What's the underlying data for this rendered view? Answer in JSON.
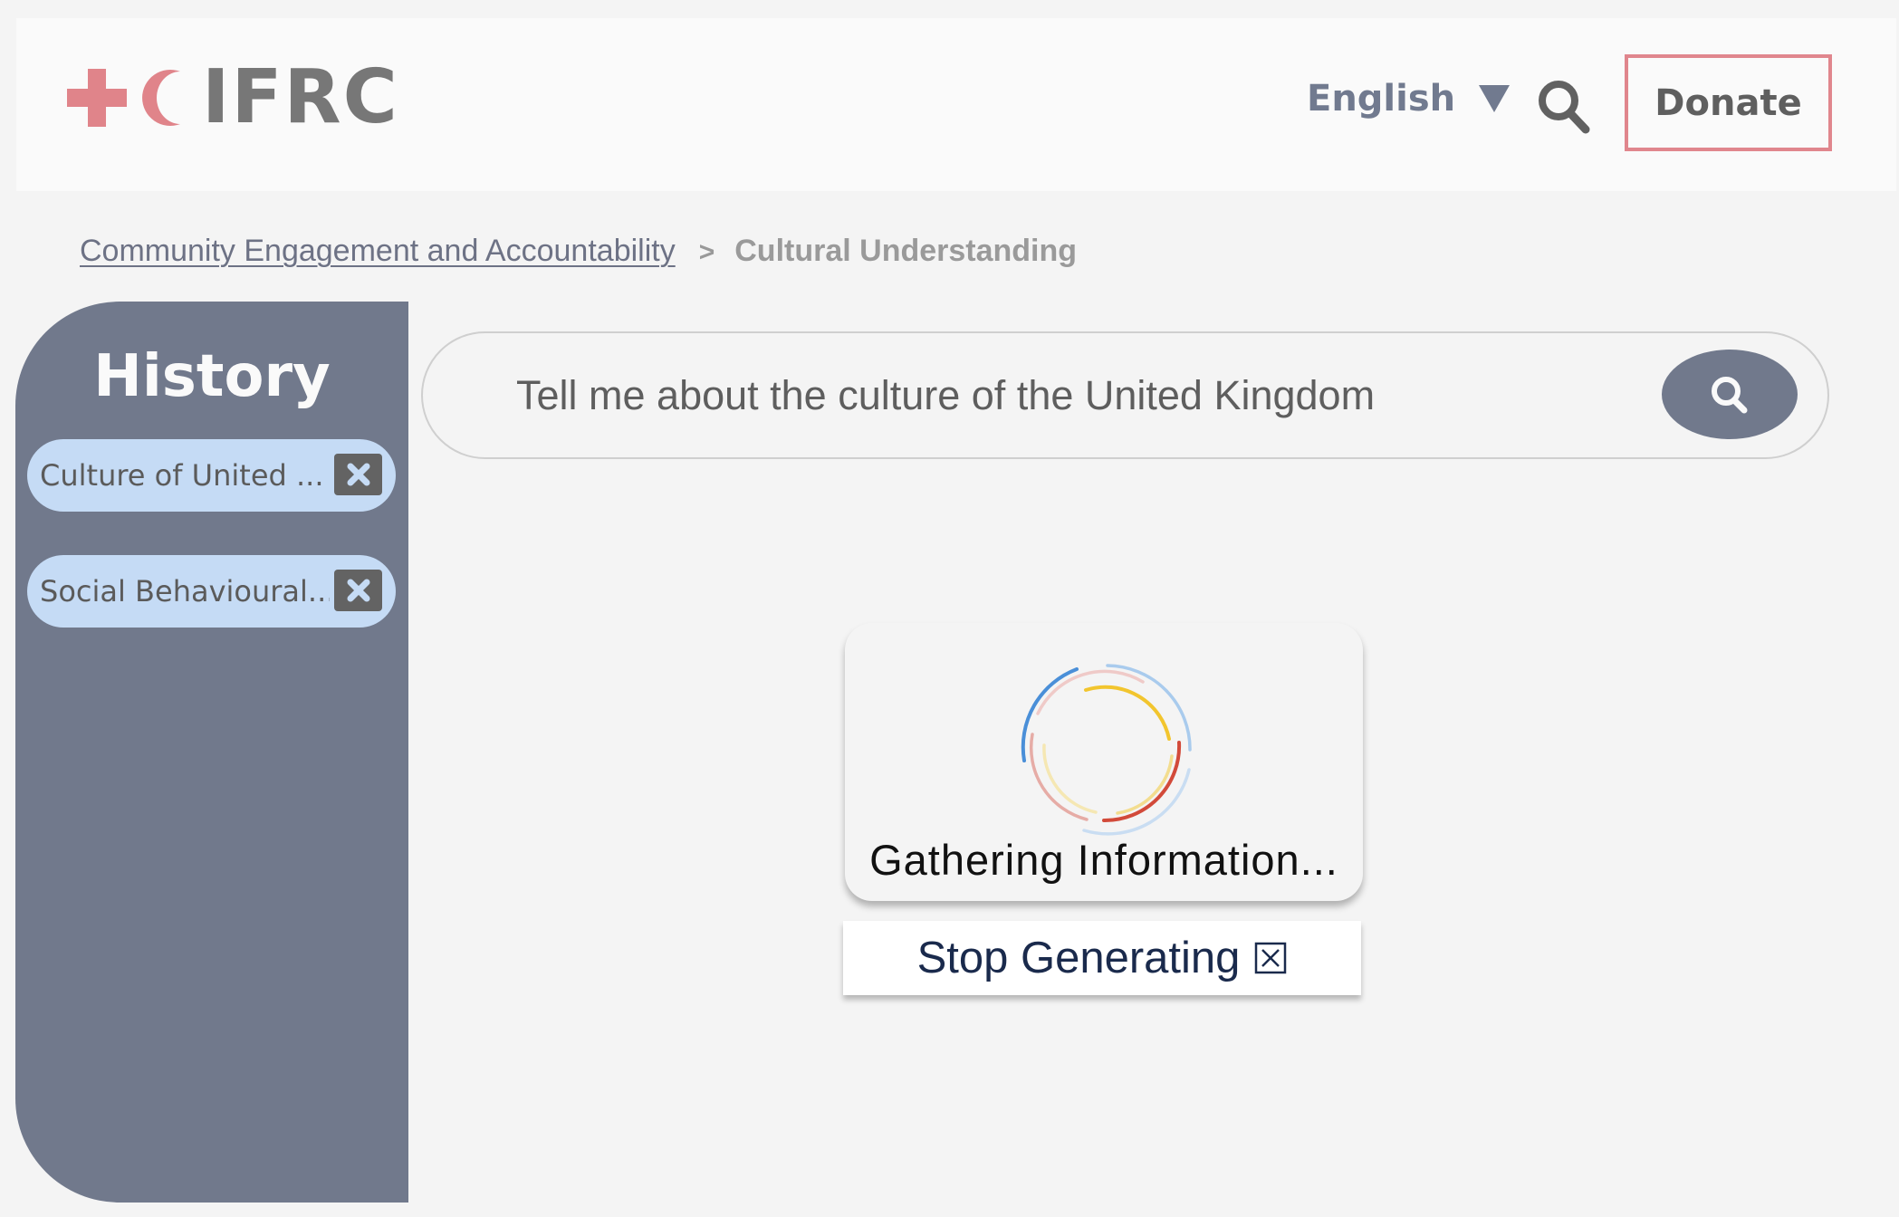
{
  "header": {
    "logo_text": "IFRC",
    "language": "English",
    "donate_label": "Donate",
    "colors": {
      "brand_red": "#e0848a",
      "accent_slate": "#71798c"
    }
  },
  "breadcrumb": {
    "parent": "Community Engagement and Accountability",
    "separator": ">",
    "current": "Cultural Understanding"
  },
  "sidebar": {
    "title": "History",
    "items": [
      {
        "label": "Culture of United ..."
      },
      {
        "label": "Social Behavioural..."
      }
    ]
  },
  "search": {
    "value": "Tell me about the culture of the United Kingdom"
  },
  "loader": {
    "status": "Gathering Information...",
    "stop_label": "Stop Generating"
  }
}
